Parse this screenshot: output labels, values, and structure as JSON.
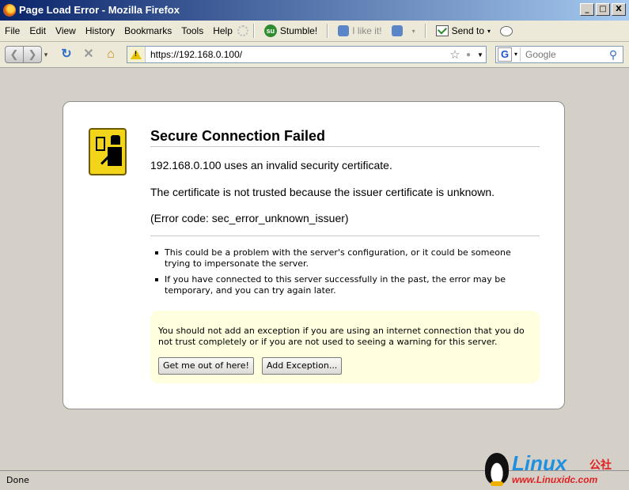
{
  "window": {
    "title": "Page Load Error - Mozilla Firefox",
    "buttons": [
      "_",
      "□",
      "X"
    ]
  },
  "menu": [
    "File",
    "Edit",
    "View",
    "History",
    "Bookmarks",
    "Tools",
    "Help"
  ],
  "toolbar": {
    "stumble_label": "Stumble!",
    "like_label": "I like it!",
    "send_label": "Send to"
  },
  "nav": {
    "url": "https://192.168.0.100/",
    "search_placeholder": "Google"
  },
  "error": {
    "title": "Secure Connection Failed",
    "para1": "192.168.0.100 uses an invalid security certificate.",
    "para2": "The certificate is not trusted because the issuer certificate is unknown.",
    "para3": "(Error code: sec_error_unknown_issuer)",
    "bullets": [
      "This could be a problem with the server's configuration, or it could be someone trying to impersonate the server.",
      "If you have connected to this server successfully in the past, the error may be temporary, and you can try again later."
    ],
    "warning": "You should not add an exception if you are using an internet connection that you do not trust completely or if you are not used to seeing a warning for this server.",
    "btn_escape": "Get me out of here!",
    "btn_exception": "Add Exception..."
  },
  "status": "Done",
  "watermark": {
    "brand": "Linux",
    "suffix": "公社",
    "url": "www.Linuxidc.com"
  },
  "colors": {
    "title_bar": "#0a246a",
    "chrome": "#d4d0c8",
    "warning_bg": "#ffffe0",
    "cert_icon": "#f2d41a"
  }
}
